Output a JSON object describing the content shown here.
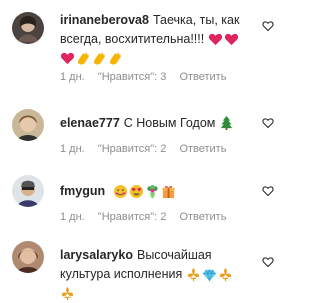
{
  "comments": [
    {
      "username": "irinaneberova8",
      "text": "Таечка, ты, как всегда, восхитительна!!!!",
      "time": "1 дн.",
      "likes": "\"Нравится\": 3",
      "reply": "Ответить",
      "emoji_after": [
        "heart-emoji",
        "heart-emoji"
      ],
      "emoji_line": [
        "heart-emoji",
        "clap-emoji",
        "clap-emoji",
        "clap-emoji"
      ]
    },
    {
      "username": "elenae777",
      "text": "С Новым Годом",
      "time": "1 дн.",
      "likes": "\"Нравится\": 2",
      "reply": "Ответить",
      "emoji_after": [
        "christmas-tree-emoji"
      ]
    },
    {
      "username": "fmygun",
      "text": "",
      "time": "1 дн.",
      "likes": "\"Нравится\": 2",
      "reply": "Ответить",
      "emoji_after": [
        "smile-emoji",
        "heart-eyes-emoji",
        "bouquet-emoji",
        "gift-emoji"
      ]
    },
    {
      "username": "larysalaryko",
      "text": "Высочайшая культура исполнения",
      "time": "",
      "likes": "",
      "reply": "",
      "emoji_after": [
        "fleur-emoji",
        "diamond-emoji",
        "fleur-emoji",
        "fleur-emoji"
      ]
    }
  ],
  "colors": {
    "username": "#262626",
    "meta": "#8e8e8e",
    "heart_red": "#e0245e",
    "clap_yellow": "#f4b400"
  }
}
